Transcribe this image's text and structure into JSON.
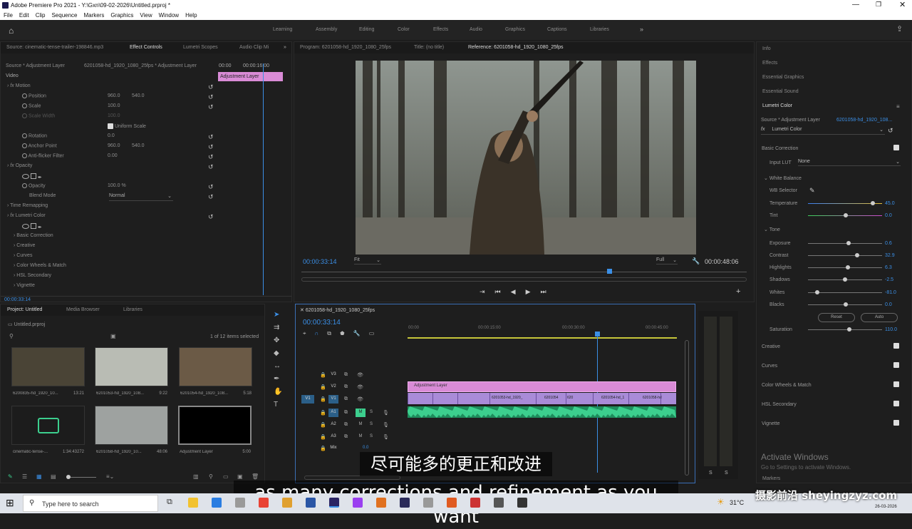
{
  "app": {
    "title": "Adobe Premiere Pro 2021 - Y:\\Gxn\\09-02-2026\\Untitled.prproj *"
  },
  "menu": [
    "File",
    "Edit",
    "Clip",
    "Sequence",
    "Markers",
    "Graphics",
    "View",
    "Window",
    "Help"
  ],
  "workspaces": [
    "Learning",
    "Assembly",
    "Editing",
    "Color",
    "Effects",
    "Audio",
    "Graphics",
    "Captions",
    "Libraries"
  ],
  "effect_panel": {
    "tabs": [
      "Source: cinematic-tense-trailer-198846.mp3",
      "Effect Controls",
      "Lumetri Scopes",
      "Audio Clip Mi"
    ],
    "source": "Source * Adjustment Layer",
    "sequence": "6201058-hd_1920_1080_25fps * Adjustment Layer",
    "mini_times": [
      "00:00",
      "00:00:16:00"
    ],
    "mini_clip": "Adjustment Layer",
    "video_label": "Video",
    "motion": "Motion",
    "position_label": "Position",
    "position_x": "960.0",
    "position_y": "540.0",
    "scale_label": "Scale",
    "scale_value": "100.0",
    "scale_width_label": "Scale Width",
    "scale_width_value": "100.0",
    "uniform_scale": "Uniform Scale",
    "rotation_label": "Rotation",
    "rotation_value": "0.0",
    "anchor_label": "Anchor Point",
    "anchor_x": "960.0",
    "anchor_y": "540.0",
    "antiflicker_label": "Anti-flicker Filter",
    "antiflicker_value": "0.00",
    "opacity": "Opacity",
    "opacity_label": "Opacity",
    "opacity_value": "100.0 %",
    "blend_label": "Blend Mode",
    "blend_value": "Normal",
    "time_remap": "Time Remapping",
    "lumetri": "Lumetri Color",
    "lumetri_sub": [
      "Basic Correction",
      "Creative",
      "Curves",
      "Color Wheels & Match",
      "HSL Secondary",
      "Vignette"
    ],
    "timecode": "00:00:33:14"
  },
  "program": {
    "tabs": [
      "Program: 6201058-hd_1920_1080_25fps",
      "Title: (no title)",
      "Reference: 6201058-hd_1920_1080_25fps"
    ],
    "timecode": "00:00:33:14",
    "fit": "Fit",
    "quality": "Full",
    "duration": "00:00:48:06"
  },
  "project": {
    "tabs": [
      "Project: Untitled",
      "Media Browser",
      "Libraries"
    ],
    "file": "Untitled.prproj",
    "count": "1 of 12 items selected",
    "items": [
      {
        "name": "6200835-hd_1920_10...",
        "dur": "13:21"
      },
      {
        "name": "6201053-hd_1920_108...",
        "dur": "9:22"
      },
      {
        "name": "6201054-hd_1920_108...",
        "dur": "5:18"
      },
      {
        "name": "cinematic-tense-...",
        "dur": "1:34:43272"
      },
      {
        "name": "6201058-hd_1920_10...",
        "dur": "48:06"
      },
      {
        "name": "Adjustment Layer",
        "dur": "5:00"
      }
    ]
  },
  "timeline": {
    "tab": "6201058-hd_1920_1080_25fps",
    "timecode": "00:00:33:14",
    "ruler": [
      "00:00",
      "00:00:15:00",
      "00:00:30:00",
      "00:00:45:00"
    ],
    "tracks": [
      "V3",
      "V2",
      "V1",
      "A1",
      "A2",
      "A3",
      "Mix"
    ],
    "mix_value": "0.0",
    "clips": {
      "adjustment": "Adjustment Layer",
      "v1": [
        "6201053-hd_1920_",
        "6201054",
        "620",
        "6201054-hd_1",
        "6201058-hd"
      ]
    },
    "ms": [
      "M",
      "S"
    ]
  },
  "meter_labels": [
    "S",
    "S"
  ],
  "right_panel": {
    "items": [
      "Info",
      "Effects",
      "Essential Graphics",
      "Essential Sound",
      "Lumetri Color"
    ],
    "source": "Source * Adjustment Layer",
    "sequence": "6201058-hd_1920_108...",
    "fx": "Lumetri Color",
    "basic": "Basic Correction",
    "input_lut": "Input LUT",
    "lut_value": "None",
    "wb": "White Balance",
    "wb_selector": "WB Selector",
    "sliders": [
      {
        "label": "Temperature",
        "value": "45.0",
        "pos": 0.88
      },
      {
        "label": "Tint",
        "value": "0.0",
        "pos": 0.5
      },
      {
        "label": "Exposure",
        "value": "0.6",
        "pos": 0.54
      },
      {
        "label": "Contrast",
        "value": "32.9",
        "pos": 0.66
      },
      {
        "label": "Highlights",
        "value": "6.3",
        "pos": 0.53
      },
      {
        "label": "Shadows",
        "value": "-2.5",
        "pos": 0.49
      },
      {
        "label": "Whites",
        "value": "-81.0",
        "pos": 0.1
      },
      {
        "label": "Blacks",
        "value": "0.0",
        "pos": 0.5
      }
    ],
    "tone": "Tone",
    "reset": "Reset",
    "auto": "Auto",
    "saturation": {
      "label": "Saturation",
      "value": "110.0",
      "pos": 0.55
    },
    "sections": [
      "Creative",
      "Curves",
      "Color Wheels & Match",
      "HSL Secondary",
      "Vignette"
    ],
    "activate": "Activate Windows",
    "activate_sub": "Go to Settings to activate Windows.",
    "markers": "Markers"
  },
  "subtitles": {
    "cn": "尽可能多的更正和改进",
    "en": "as many corrections and refinement as you want"
  },
  "taskbar": {
    "search": "Type here to search",
    "temp": "31°C",
    "date": "26-03-2026"
  },
  "watermark": "摄影前沿 sheyingzyz.com",
  "colors": {
    "accent": "#3b8fe6",
    "adjustment": "#d98bd6",
    "audio": "#3ccf8e",
    "video": "#a98bd8"
  }
}
